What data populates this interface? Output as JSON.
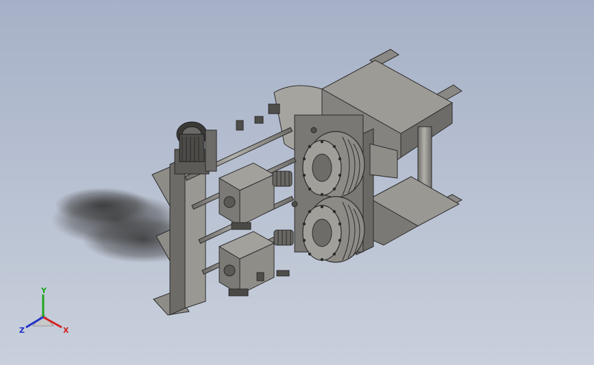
{
  "viewport": {
    "background_top": "#a6b1c7",
    "background_bottom": "#c9d0dc"
  },
  "triad": {
    "x_label": "X",
    "y_label": "Y",
    "z_label": "Z",
    "x_color": "#d42020",
    "y_color": "#1fa51f",
    "z_color": "#2030c8"
  },
  "model": {
    "description_icon": "machine-assembly-icon",
    "metal_color": "#8c8a86",
    "dark_metal_color": "#4a4946",
    "shadow_color": "#3c3c3c"
  }
}
